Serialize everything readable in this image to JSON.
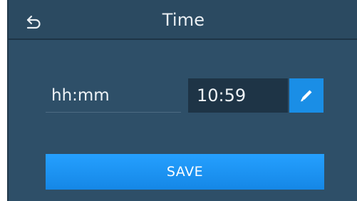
{
  "header": {
    "title": "Time",
    "back_icon": "back-arrow-icon"
  },
  "time_setting": {
    "label": "hh:mm",
    "value": "10:59",
    "edit_icon": "pencil-icon"
  },
  "actions": {
    "save_label": "SAVE"
  },
  "colors": {
    "panel": "#2e4f68",
    "header": "#2b4a61",
    "value_box": "#1e3446",
    "accent": "#1a8ee6"
  }
}
